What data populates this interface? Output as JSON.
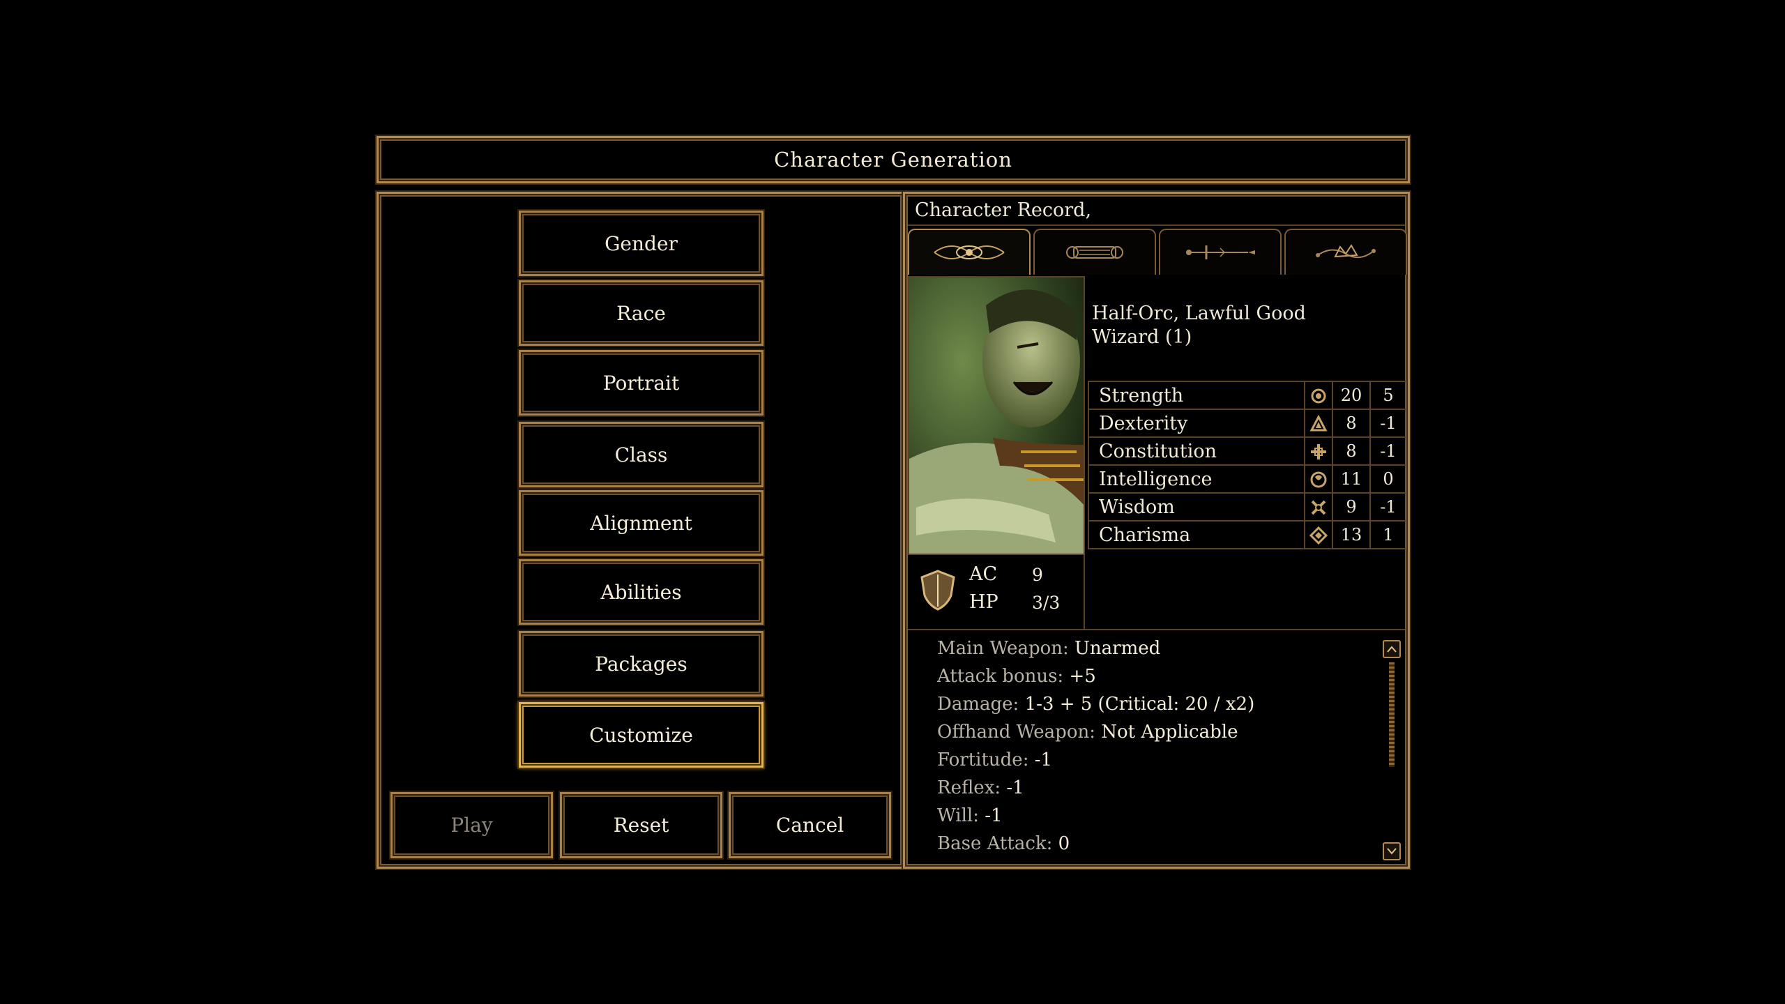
{
  "title": "Character Generation",
  "nav": {
    "gender": "Gender",
    "race": "Race",
    "portrait": "Portrait",
    "class": "Class",
    "alignment": "Alignment",
    "abilities": "Abilities",
    "packages": "Packages",
    "customize": "Customize",
    "active": "Customize"
  },
  "actions": {
    "play": "Play",
    "reset": "Reset",
    "cancel": "Cancel"
  },
  "record": {
    "header": "Character Record,",
    "tabs": [
      "eye-tab-icon",
      "scroll-tab-icon",
      "sword-tab-icon",
      "crown-tab-icon"
    ],
    "race_alignment": "Half-Orc, Lawful Good",
    "class_level": "Wizard (1)",
    "abilities": [
      {
        "name": "Strength",
        "icon": "strength-icon",
        "score": "20",
        "mod": "5"
      },
      {
        "name": "Dexterity",
        "icon": "dexterity-icon",
        "score": "8",
        "mod": "-1"
      },
      {
        "name": "Constitution",
        "icon": "constitution-icon",
        "score": "8",
        "mod": "-1"
      },
      {
        "name": "Intelligence",
        "icon": "intelligence-icon",
        "score": "11",
        "mod": "0"
      },
      {
        "name": "Wisdom",
        "icon": "wisdom-icon",
        "score": "9",
        "mod": "-1"
      },
      {
        "name": "Charisma",
        "icon": "charisma-icon",
        "score": "13",
        "mod": "1"
      }
    ],
    "ac_label": "AC",
    "ac_value": "9",
    "hp_label": "HP",
    "hp_value": "3/3",
    "stats": [
      {
        "key": "Main Weapon:",
        "value": "Unarmed"
      },
      {
        "key": "Attack bonus:",
        "value": "+5"
      },
      {
        "key": "Damage:",
        "value": "1-3 + 5 (Critical: 20 / x2)"
      },
      {
        "key": "Offhand Weapon:",
        "value": "Not Applicable"
      },
      {
        "key": "Fortitude:",
        "value": "-1"
      },
      {
        "key": "Reflex:",
        "value": "-1"
      },
      {
        "key": "Will:",
        "value": "-1"
      },
      {
        "key": "Base Attack:",
        "value": "0"
      }
    ]
  },
  "colors": {
    "gold_border": "#b48a52",
    "active_border": "#e0b457",
    "background": "#000000",
    "disabled_text": "#8a847a"
  }
}
